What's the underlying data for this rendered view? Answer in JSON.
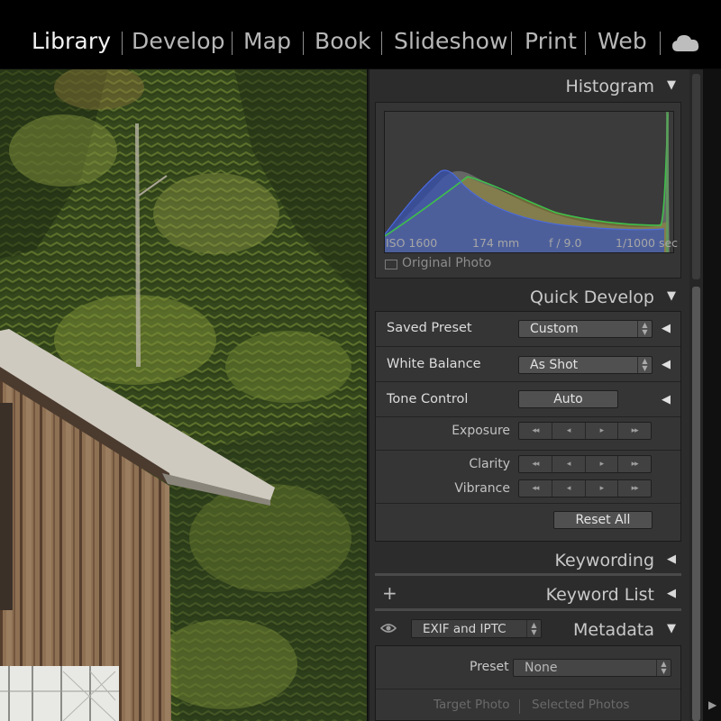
{
  "nav": {
    "modules": [
      "Library",
      "Develop",
      "Map",
      "Book",
      "Slideshow",
      "Print",
      "Web"
    ],
    "active": "Library",
    "cloud_icon": "cloud-icon"
  },
  "histogram": {
    "title": "Histogram",
    "iso": "ISO 1600",
    "focal_length": "174 mm",
    "aperture": "f / 9.0",
    "shutter": "1/1000 sec",
    "original_photo_label": "Original Photo",
    "colors": {
      "blue": "#3c58b8",
      "green": "#3fae3f",
      "yellow": "#a49a3a",
      "gray": "#8e8e8e"
    }
  },
  "quick_develop": {
    "title": "Quick Develop",
    "saved_preset": {
      "label": "Saved Preset",
      "value": "Custom"
    },
    "white_balance": {
      "label": "White Balance",
      "value": "As Shot"
    },
    "tone_control": {
      "label": "Tone Control",
      "button": "Auto"
    },
    "exposure_label": "Exposure",
    "clarity_label": "Clarity",
    "vibrance_label": "Vibrance",
    "reset_all": "Reset All"
  },
  "sections": {
    "keywording": "Keywording",
    "keyword_list": "Keyword List",
    "metadata": "Metadata",
    "plus_symbol": "+"
  },
  "metadata": {
    "view_value": "EXIF and IPTC",
    "preset_label": "Preset",
    "preset_value": "None",
    "target_photo": "Target Photo",
    "selected_photos": "Selected Photos"
  }
}
